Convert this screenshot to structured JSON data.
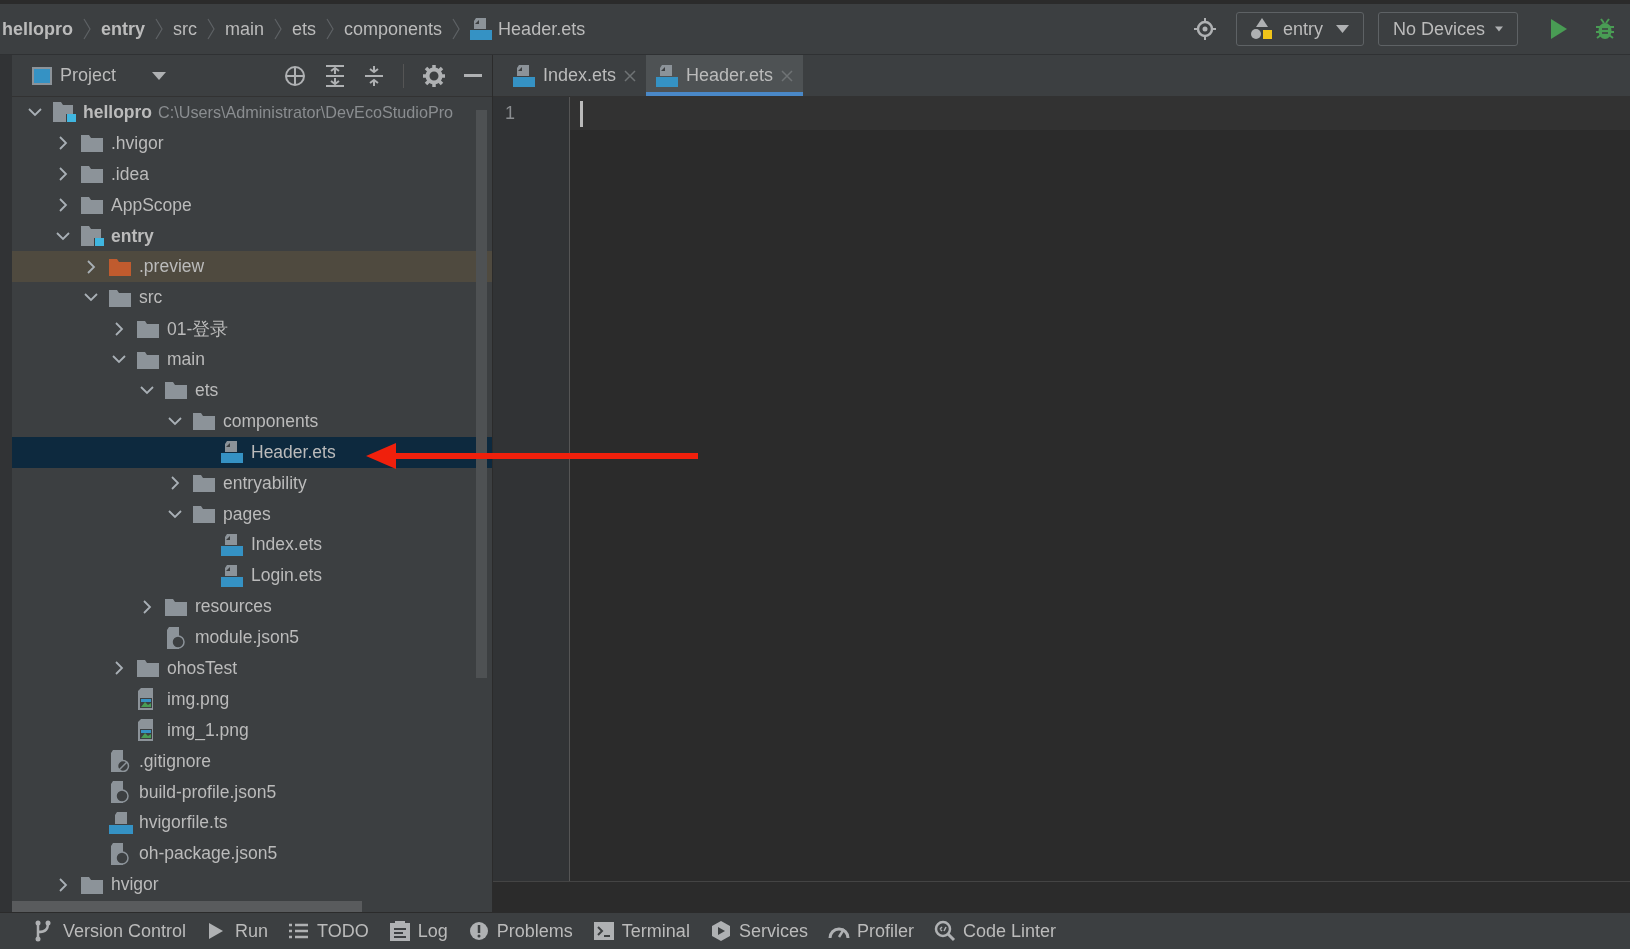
{
  "navbar": {
    "breadcrumbs": [
      {
        "label": "hellopro",
        "kind": "module"
      },
      {
        "label": "entry",
        "kind": "module"
      },
      {
        "label": "src",
        "kind": "folder"
      },
      {
        "label": "main",
        "kind": "folder"
      },
      {
        "label": "ets",
        "kind": "folder"
      },
      {
        "label": "components",
        "kind": "folder"
      },
      {
        "label": "Header.ets",
        "kind": "ets"
      }
    ],
    "run_config": "entry",
    "device": "No Devices"
  },
  "project": {
    "title": "Project",
    "tree": [
      {
        "label": "hellopro",
        "path": "C:\\Users\\Administrator\\DevEcoStudioPro",
        "kind": "module",
        "expanded": true,
        "selected": false,
        "children": [
          {
            "label": ".hvigor",
            "kind": "folder",
            "expanded": false,
            "selected": false
          },
          {
            "label": ".idea",
            "kind": "folder",
            "expanded": false,
            "selected": false
          },
          {
            "label": "AppScope",
            "kind": "folder",
            "expanded": false,
            "selected": false
          },
          {
            "label": "entry",
            "kind": "module",
            "expanded": true,
            "selected": false,
            "children": [
              {
                "label": ".preview",
                "kind": "excluded",
                "expanded": false,
                "selected": false
              },
              {
                "label": "src",
                "kind": "folder",
                "expanded": true,
                "selected": false,
                "children": [
                  {
                    "label": "01-登录",
                    "kind": "folder",
                    "expanded": false,
                    "selected": false
                  },
                  {
                    "label": "main",
                    "kind": "folder",
                    "expanded": true,
                    "selected": false,
                    "children": [
                      {
                        "label": "ets",
                        "kind": "folder",
                        "expanded": true,
                        "selected": false,
                        "children": [
                          {
                            "label": "components",
                            "kind": "folder",
                            "expanded": true,
                            "selected": false,
                            "children": [
                              {
                                "label": "Header.ets",
                                "kind": "ets",
                                "selected": true
                              }
                            ]
                          },
                          {
                            "label": "entryability",
                            "kind": "folder",
                            "expanded": false,
                            "selected": false
                          },
                          {
                            "label": "pages",
                            "kind": "folder",
                            "expanded": true,
                            "selected": false,
                            "children": [
                              {
                                "label": "Index.ets",
                                "kind": "ets",
                                "selected": false
                              },
                              {
                                "label": "Login.ets",
                                "kind": "ets",
                                "selected": false
                              }
                            ]
                          }
                        ]
                      },
                      {
                        "label": "resources",
                        "kind": "folder",
                        "expanded": false,
                        "selected": false
                      },
                      {
                        "label": "module.json5",
                        "kind": "json",
                        "selected": false
                      }
                    ]
                  },
                  {
                    "label": "ohosTest",
                    "kind": "folder",
                    "expanded": false,
                    "selected": false
                  },
                  {
                    "label": "img.png",
                    "kind": "image",
                    "selected": false
                  },
                  {
                    "label": "img_1.png",
                    "kind": "image",
                    "selected": false
                  }
                ]
              },
              {
                "label": ".gitignore",
                "kind": "ignore",
                "selected": false
              },
              {
                "label": "build-profile.json5",
                "kind": "json",
                "selected": false
              },
              {
                "label": "hvigorfile.ts",
                "kind": "ts",
                "selected": false
              },
              {
                "label": "oh-package.json5",
                "kind": "json",
                "selected": false
              }
            ]
          },
          {
            "label": "hvigor",
            "kind": "folder",
            "expanded": false,
            "selected": false
          }
        ]
      }
    ]
  },
  "editor": {
    "tabs": [
      {
        "label": "Index.ets",
        "kind": "ets",
        "selected": false
      },
      {
        "label": "Header.ets",
        "kind": "ets",
        "selected": true
      }
    ],
    "line_numbers": [
      "1"
    ]
  },
  "tool_windows": [
    {
      "label": "Version Control",
      "kind": "vcs"
    },
    {
      "label": "Run",
      "kind": "run"
    },
    {
      "label": "TODO",
      "kind": "todo"
    },
    {
      "label": "Log",
      "kind": "log"
    },
    {
      "label": "Problems",
      "kind": "problems"
    },
    {
      "label": "Terminal",
      "kind": "terminal"
    },
    {
      "label": "Services",
      "kind": "services"
    },
    {
      "label": "Profiler",
      "kind": "profiler"
    },
    {
      "label": "Code Linter",
      "kind": "linter"
    }
  ]
}
